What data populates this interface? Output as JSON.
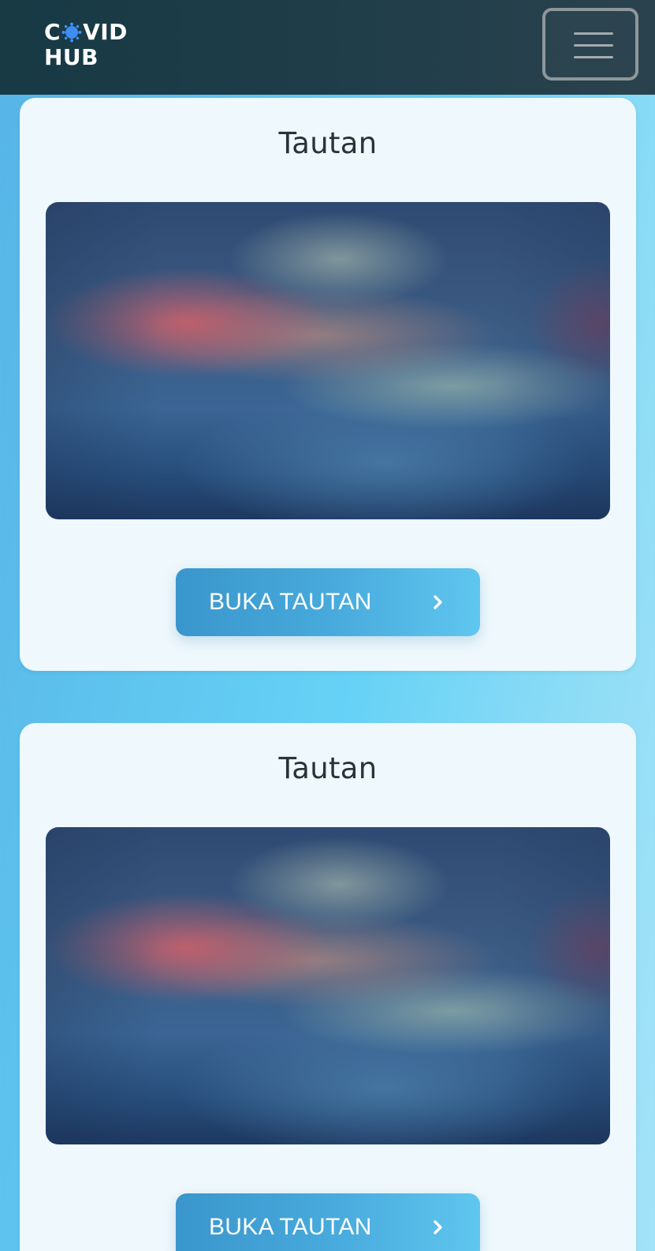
{
  "header": {
    "logo": {
      "line1_prefix": "C",
      "line1_suffix": "VID",
      "line2": "HUB",
      "icon": "virus-icon",
      "icon_color": "#3d8ef0"
    },
    "menu_icon": "hamburger-menu-icon"
  },
  "cards": [
    {
      "title": "Tautan",
      "button_label": "BUKA TAUTAN",
      "button_icon": "chevron-right-icon"
    },
    {
      "title": "Tautan",
      "button_label": "BUKA TAUTAN",
      "button_icon": "chevron-right-icon"
    }
  ],
  "colors": {
    "header_bg": "#1f3d49",
    "card_bg": "#eff8fc",
    "button_start": "#3a96cc",
    "button_end": "#5fc6ef",
    "page_bg": "#67d2f6"
  }
}
